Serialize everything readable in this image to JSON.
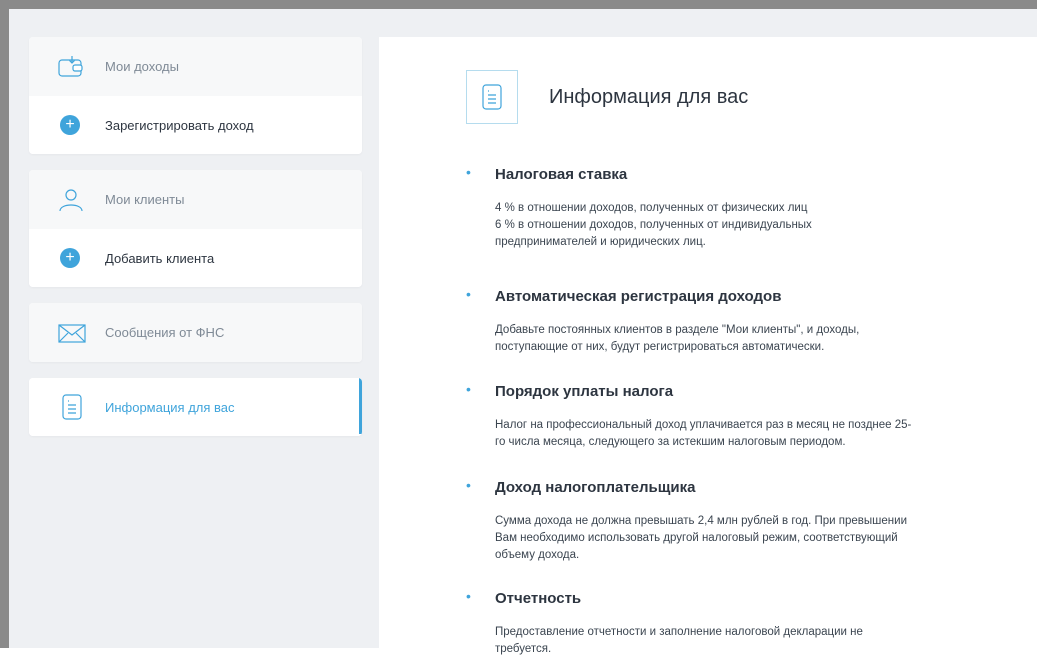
{
  "sidebar": {
    "income": {
      "title": "Мои доходы",
      "action": "Зарегистрировать доход"
    },
    "clients": {
      "title": "Мои клиенты",
      "action": "Добавить клиента"
    },
    "messages": {
      "title": "Сообщения от ФНС"
    },
    "info": {
      "title": "Информация для вас"
    }
  },
  "main": {
    "title": "Информация для вас",
    "sections": [
      {
        "title": "Налоговая ставка",
        "body": "4 % в отношении доходов, полученных от физических лиц\n6 % в отношении доходов, полученных от индивидуальных\nпредпринимателей и юридических лиц."
      },
      {
        "title": "Автоматическая регистрация доходов",
        "body": "Добавьте постоянных клиентов в разделе \"Мои клиенты\", и доходы,\nпоступающие от них, будут регистрироваться автоматически."
      },
      {
        "title": "Порядок уплаты налога",
        "body": "Налог на профессиональный доход уплачивается раз в месяц не позднее 25-\nго числа месяца, следующего за истекшим налоговым периодом."
      },
      {
        "title": "Доход налогоплательщика",
        "body": "Сумма дохода не должна превышать 2,4 млн рублей в год. При превышении\nВам необходимо использовать другой налоговый режим, соответствующий\nобъему дохода."
      },
      {
        "title": "Отчетность",
        "body": "Предоставление отчетности и заполнение налоговой декларации не\nтребуется."
      }
    ]
  },
  "colors": {
    "accent": "#3fa4db",
    "text": "#2d3540",
    "muted": "#7f8a96",
    "background": "#eef0f3"
  }
}
